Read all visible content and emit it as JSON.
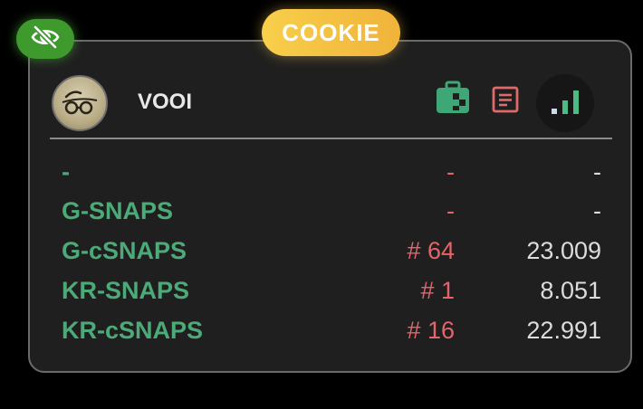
{
  "widget": {
    "title": "COOKIE",
    "hide_icon": "eye-slash-icon",
    "accent_color": "#f5c142",
    "toggle_color": "#3e9a2c"
  },
  "header": {
    "username": "VOOI",
    "icons": [
      "briefcase-icon",
      "document-icon",
      "signal-bars-icon"
    ]
  },
  "rows": [
    {
      "name": "-",
      "rank": "-",
      "value": "-"
    },
    {
      "name": "G-SNAPS",
      "rank": "-",
      "value": "-"
    },
    {
      "name": "G-cSNAPS",
      "rank": "# 64",
      "value": "23.009"
    },
    {
      "name": "KR-SNAPS",
      "rank": "# 1",
      "value": "8.051"
    },
    {
      "name": "KR-cSNAPS",
      "rank": "# 16",
      "value": "22.991"
    }
  ]
}
